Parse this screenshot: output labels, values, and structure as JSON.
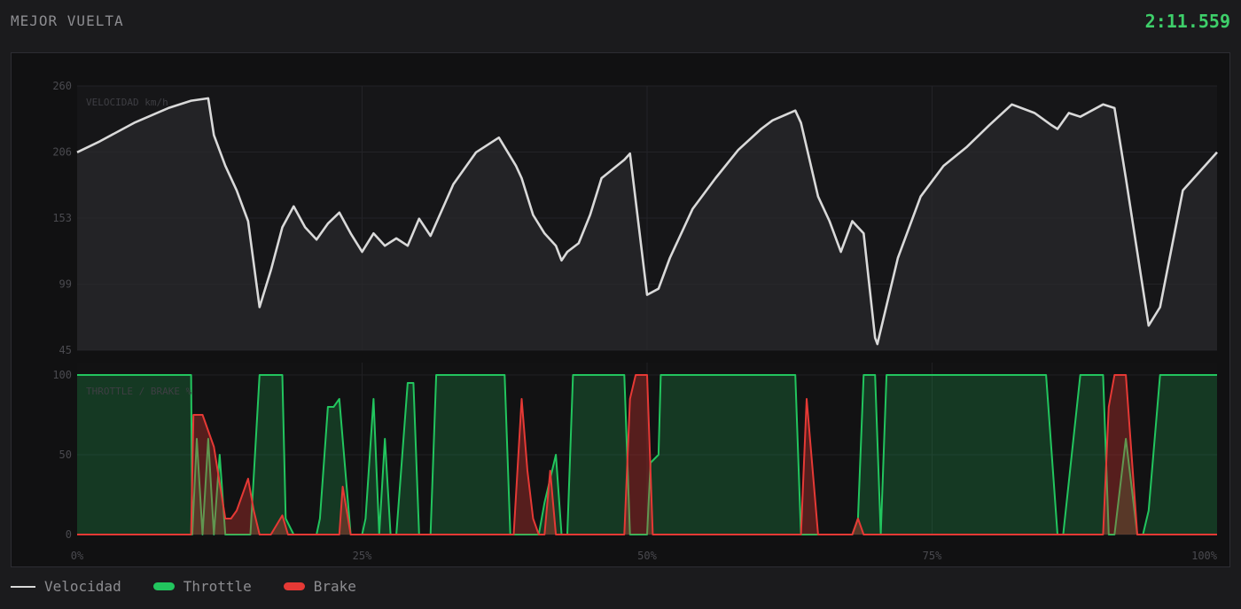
{
  "header": {
    "title": "MEJOR VUELTA",
    "lap_time": "2:11.559"
  },
  "colors": {
    "speed": "#d9d9d9",
    "throttle": "#22c55e",
    "brake": "#e53935"
  },
  "chart_data": [
    {
      "type": "line",
      "title": "VELOCIDAD km/h",
      "xlabel": "",
      "ylabel": "",
      "ylim": [
        45,
        260
      ],
      "y_ticks": [
        "260",
        "206",
        "153",
        "99",
        "45"
      ],
      "x_ticks": [
        "0%",
        "25%",
        "50%",
        "75%",
        "100%"
      ],
      "grid": true,
      "series": [
        {
          "name": "Velocidad",
          "x": [
            0,
            2,
            5,
            8,
            10,
            11.5,
            12,
            13,
            14,
            15,
            16,
            17,
            18,
            19,
            20,
            21,
            22,
            23,
            24,
            25,
            26,
            27,
            28,
            29,
            30,
            31,
            33,
            35,
            37,
            38.5,
            39,
            40,
            41,
            42,
            42.5,
            43,
            44,
            45,
            46,
            48,
            48.5,
            50,
            51,
            52,
            54,
            56,
            58,
            60,
            61,
            63,
            63.5,
            65,
            66,
            67,
            68,
            69,
            70,
            70.2,
            72,
            74,
            76,
            78,
            80,
            82,
            84,
            85.5,
            86,
            87,
            88,
            90,
            91,
            92,
            94,
            95,
            97,
            100
          ],
          "y": [
            206,
            215,
            230,
            242,
            248,
            250,
            220,
            195,
            175,
            150,
            80,
            110,
            145,
            162,
            145,
            135,
            148,
            157,
            140,
            125,
            140,
            130,
            136,
            130,
            152,
            138,
            180,
            206,
            218,
            195,
            185,
            155,
            140,
            130,
            118,
            125,
            132,
            155,
            185,
            200,
            205,
            90,
            95,
            120,
            160,
            185,
            208,
            225,
            232,
            240,
            230,
            170,
            150,
            125,
            150,
            140,
            55,
            50,
            120,
            170,
            195,
            210,
            228,
            245,
            238,
            228,
            225,
            238,
            235,
            245,
            242,
            185,
            65,
            80,
            175,
            206
          ]
        }
      ]
    },
    {
      "type": "area",
      "title": "THROTTLE / BRAKE %",
      "xlabel": "",
      "ylabel": "",
      "ylim": [
        0,
        100
      ],
      "y_ticks": [
        "100",
        "50",
        "0"
      ],
      "x_ticks": [
        "0%",
        "25%",
        "50%",
        "75%",
        "100%"
      ],
      "grid": true,
      "series": [
        {
          "name": "Throttle",
          "x": [
            0,
            10,
            10.1,
            10.5,
            11,
            11.5,
            12,
            12.5,
            13,
            14,
            15,
            15.2,
            16,
            16.5,
            18,
            18.3,
            19,
            20,
            21,
            21.3,
            22,
            22.5,
            23,
            24,
            25,
            25.3,
            26,
            26.5,
            27,
            27.5,
            28,
            29,
            29.5,
            30,
            31,
            31.5,
            33,
            37,
            37.5,
            38,
            38.5,
            40,
            40.5,
            41,
            42,
            42.5,
            43,
            43.5,
            44,
            45,
            46,
            48,
            48.5,
            50,
            50.3,
            51,
            51.2,
            55,
            60,
            63,
            63.5,
            64,
            65,
            66,
            67,
            68,
            68.5,
            69,
            70,
            70.5,
            71,
            75,
            80,
            84,
            85,
            86,
            86.5,
            88,
            90,
            90.5,
            91,
            92,
            93,
            93.5,
            94,
            95,
            96,
            97,
            100
          ],
          "y": [
            100,
            100,
            0,
            60,
            0,
            60,
            0,
            50,
            0,
            0,
            0,
            0,
            100,
            100,
            100,
            10,
            0,
            0,
            0,
            10,
            80,
            80,
            85,
            0,
            0,
            10,
            85,
            0,
            60,
            0,
            0,
            95,
            95,
            0,
            0,
            100,
            100,
            100,
            100,
            0,
            0,
            0,
            0,
            20,
            50,
            0,
            0,
            100,
            100,
            100,
            100,
            100,
            0,
            0,
            45,
            50,
            100,
            100,
            100,
            100,
            0,
            0,
            0,
            0,
            0,
            0,
            10,
            100,
            100,
            0,
            100,
            100,
            100,
            100,
            100,
            0,
            0,
            100,
            100,
            0,
            0,
            60,
            0,
            0,
            15,
            100,
            100,
            100,
            100
          ]
        },
        {
          "name": "Brake",
          "x": [
            0,
            10,
            10.2,
            11,
            12,
            13,
            13.5,
            14,
            15,
            15.5,
            16,
            17,
            18,
            18.5,
            19,
            20,
            23,
            23.3,
            24,
            25,
            30,
            36,
            37.5,
            38,
            38.3,
            39,
            39.5,
            40,
            40.5,
            41,
            41.5,
            42,
            43,
            48,
            48.5,
            49,
            50,
            50.5,
            51,
            55,
            63,
            63.5,
            64,
            65,
            65.5,
            66,
            67,
            68,
            68.5,
            69,
            70,
            75,
            85,
            90,
            90.5,
            91,
            92,
            93,
            93.5,
            94,
            100
          ],
          "y": [
            0,
            0,
            75,
            75,
            55,
            10,
            10,
            15,
            35,
            15,
            0,
            0,
            12,
            0,
            0,
            0,
            0,
            30,
            0,
            0,
            0,
            0,
            0,
            0,
            0,
            85,
            40,
            10,
            0,
            0,
            40,
            0,
            0,
            0,
            85,
            100,
            100,
            0,
            0,
            0,
            0,
            0,
            85,
            0,
            0,
            0,
            0,
            0,
            10,
            0,
            0,
            0,
            0,
            0,
            80,
            100,
            100,
            0,
            0,
            0,
            0
          ]
        }
      ]
    }
  ],
  "legend": {
    "speed": "Velocidad",
    "throttle": "Throttle",
    "brake": "Brake"
  }
}
